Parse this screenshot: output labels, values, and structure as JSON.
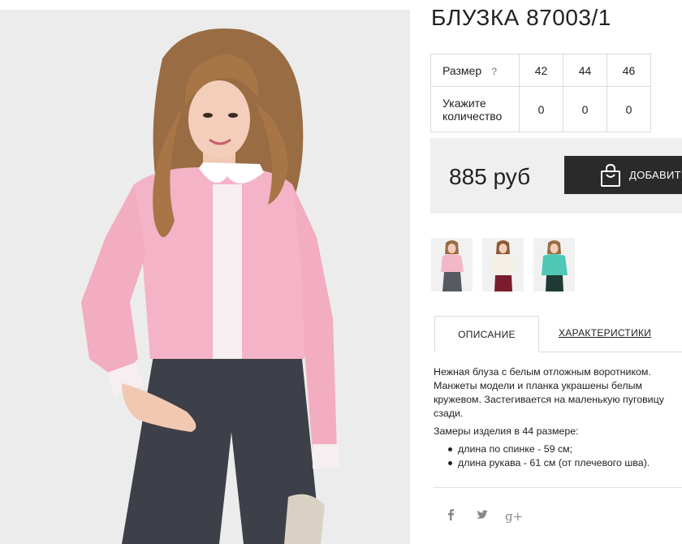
{
  "product": {
    "title": "БЛУЗКА 87003/1"
  },
  "sizes": {
    "row_label": "Размер",
    "help_icon": "?",
    "values": [
      "42",
      "44",
      "46"
    ],
    "qty_label_line1": "Укажите",
    "qty_label_line2": "количество",
    "quantities": [
      "0",
      "0",
      "0"
    ]
  },
  "purchase": {
    "price": "885 руб",
    "add_button_label": "ДОБАВИТЬ",
    "button_icon": "shopping-bag-icon"
  },
  "thumbnails": [
    {
      "color": "#f2b7c8",
      "pants": "#555a63",
      "alt": "pink"
    },
    {
      "color": "#f5f0e6",
      "pants": "#7a1c2e",
      "alt": "cream"
    },
    {
      "color": "#4fc8b8",
      "pants": "#1f3a34",
      "alt": "mint"
    }
  ],
  "tabs": {
    "description": "ОПИСАНИЕ",
    "characteristics": "ХАРАКТЕРИСТИКИ"
  },
  "description": {
    "line1": "Нежная блуза с белым отложным воротником.",
    "line2": "Манжеты модели и планка украшены белым",
    "line3": "кружевом. Застегивается на маленькую пуговицу",
    "line4": "сзади.",
    "measurements_title": "Замеры изделия в 44 размере:",
    "measurements": [
      "длина по спинке - 59 см;",
      "длина рукава - 61 см (от плечевого шва)."
    ]
  },
  "social": {
    "facebook": "f",
    "twitter": "🐦",
    "google": "g+"
  },
  "colors": {
    "blouse": "#f4b3c6",
    "jeans": "#3d4048",
    "button_bg": "#2a2a2a",
    "price_band": "#efefef"
  }
}
